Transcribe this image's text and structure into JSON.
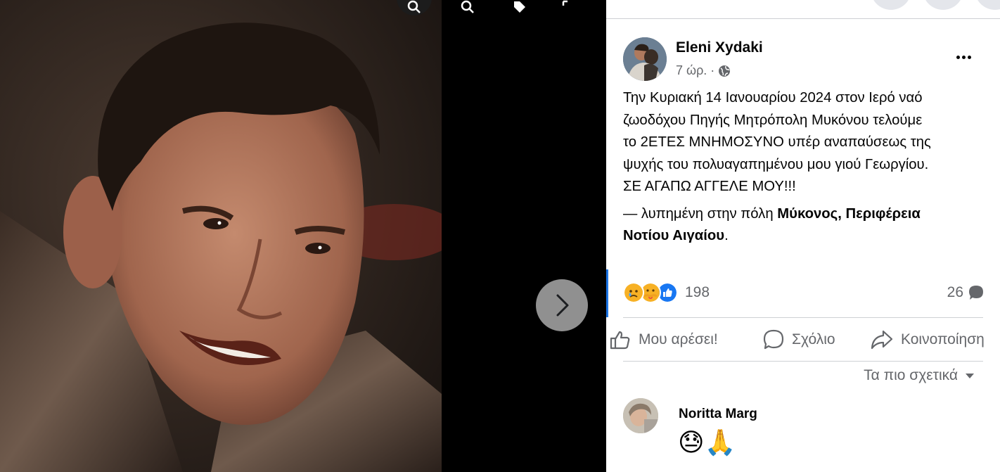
{
  "post": {
    "author": "Eleni Xydaki",
    "time": "7 ώρ. ·",
    "body_lines": [
      "Την Κυριακή 14 Ιανουαρίου 2024 στον Ιερό ναό",
      "ζωοδόχου Πηγής Μητρόπολη Μυκόνου τελούμε",
      "το 2ΕΤΕΣ ΜΝΗΜΟΣΥΝΟ υπέρ αναπαύσεως της",
      "ψυχής του πολυαγαπημένου μου γιού Γεωργίου.",
      "ΣΕ ΑΓΑΠΩ ΑΓΓΕΛΕ ΜΟΥ!!!"
    ],
    "feeling_prefix": "— λυπημένη στην πόλη ",
    "location_part1": "Μύκονος, Περιφέρεια",
    "location_part2": "Νοτίου Αιγαίου",
    "location_suffix": "."
  },
  "stats": {
    "reactions_count": "198",
    "comments_count": "26"
  },
  "actions": {
    "like": "Μου αρέσει!",
    "comment": "Σχόλιο",
    "share": "Κοινοποίηση"
  },
  "sort": {
    "label": "Τα πιο σχετικά"
  },
  "comments": [
    {
      "name": "Noritta Marg",
      "text": "😓🙏"
    }
  ],
  "icons": [
    "search-icon",
    "zoom-out-icon",
    "tag-icon",
    "fullscreen-icon",
    "chevron-right-icon",
    "globe-icon",
    "more-icon",
    "like-icon",
    "comment-icon",
    "share-icon",
    "caret-down-icon"
  ],
  "colors": {
    "accent": "#1b74e4",
    "secondary_text": "#65676b",
    "text": "#050505",
    "divider": "#ced0d4"
  }
}
